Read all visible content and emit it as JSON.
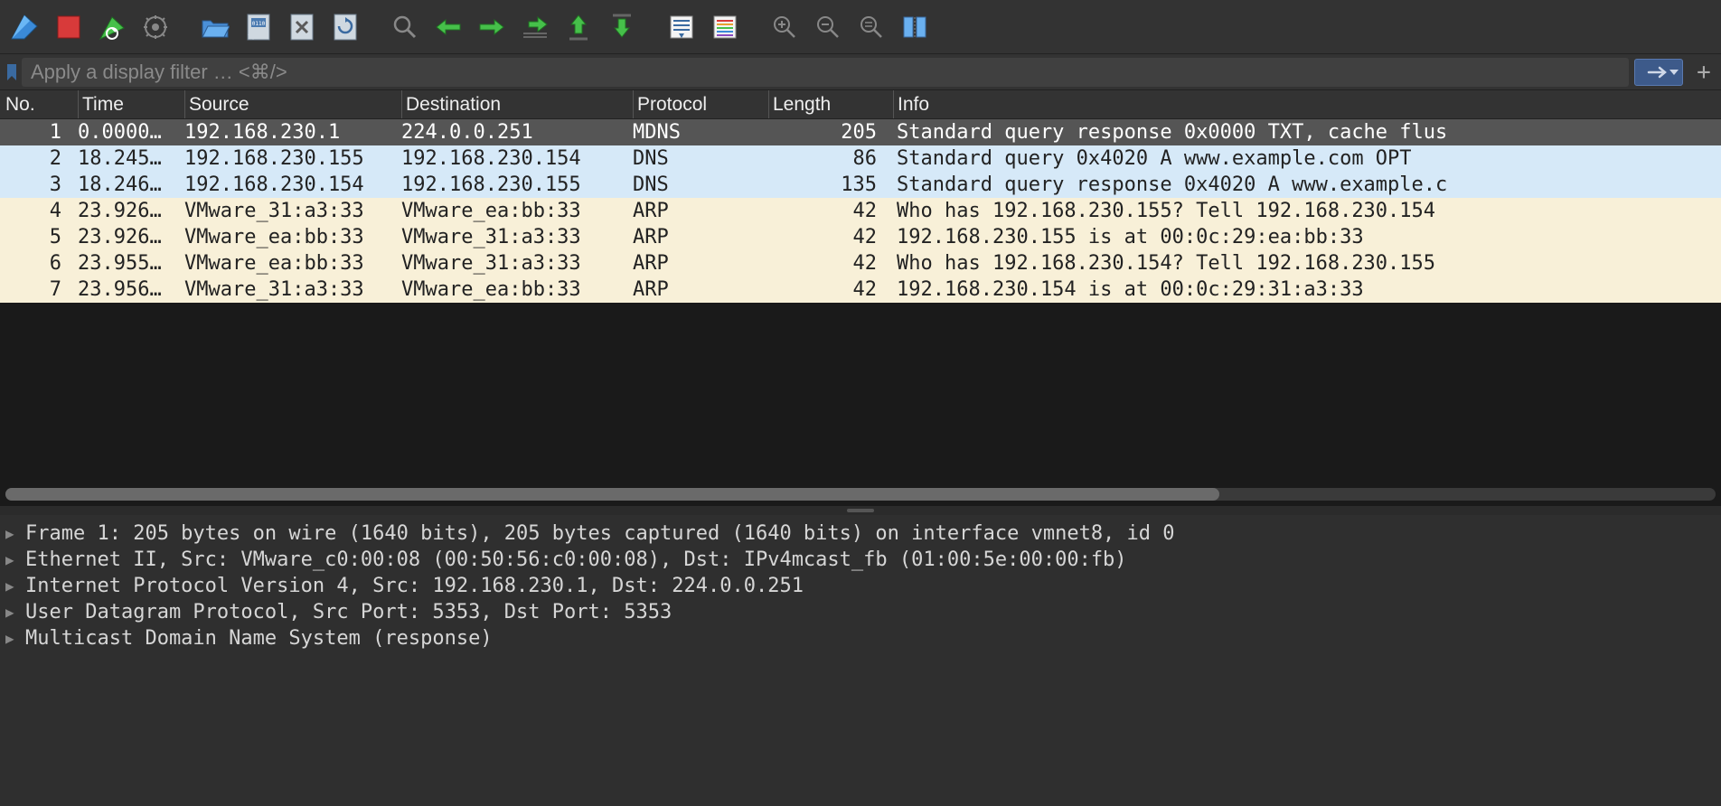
{
  "toolbar": {
    "icons": [
      "fin-icon",
      "stop-icon",
      "restart-icon",
      "options-icon",
      "open-folder-icon",
      "save-icon",
      "close-file-icon",
      "reload-icon",
      "find-icon",
      "prev-icon",
      "next-icon",
      "jump-icon",
      "first-icon",
      "last-icon",
      "autoscroll-icon",
      "colorize-icon",
      "zoom-in-icon",
      "zoom-out-icon",
      "zoom-reset-icon",
      "resize-cols-icon"
    ]
  },
  "filter": {
    "placeholder": "Apply a display filter … <⌘/>",
    "go_label": "→",
    "plus_label": "+"
  },
  "columns": {
    "no": "No.",
    "time": "Time",
    "source": "Source",
    "destination": "Destination",
    "protocol": "Protocol",
    "length": "Length",
    "info": "Info"
  },
  "packets": [
    {
      "no": "1",
      "time": "0.0000…",
      "src": "192.168.230.1",
      "dst": "224.0.0.251",
      "proto": "MDNS",
      "len": "205",
      "info": "Standard query response 0x0000 TXT, cache flus",
      "class": "selected"
    },
    {
      "no": "2",
      "time": "18.245…",
      "src": "192.168.230.155",
      "dst": "192.168.230.154",
      "proto": "DNS",
      "len": "86",
      "info": "Standard query 0x4020 A www.example.com OPT",
      "class": "dns"
    },
    {
      "no": "3",
      "time": "18.246…",
      "src": "192.168.230.154",
      "dst": "192.168.230.155",
      "proto": "DNS",
      "len": "135",
      "info": "Standard query response 0x4020 A www.example.c",
      "class": "dns"
    },
    {
      "no": "4",
      "time": "23.926…",
      "src": "VMware_31:a3:33",
      "dst": "VMware_ea:bb:33",
      "proto": "ARP",
      "len": "42",
      "info": "Who has 192.168.230.155? Tell 192.168.230.154",
      "class": "arp"
    },
    {
      "no": "5",
      "time": "23.926…",
      "src": "VMware_ea:bb:33",
      "dst": "VMware_31:a3:33",
      "proto": "ARP",
      "len": "42",
      "info": "192.168.230.155 is at 00:0c:29:ea:bb:33",
      "class": "arp"
    },
    {
      "no": "6",
      "time": "23.955…",
      "src": "VMware_ea:bb:33",
      "dst": "VMware_31:a3:33",
      "proto": "ARP",
      "len": "42",
      "info": "Who has 192.168.230.154? Tell 192.168.230.155",
      "class": "arp"
    },
    {
      "no": "7",
      "time": "23.956…",
      "src": "VMware_31:a3:33",
      "dst": "VMware_ea:bb:33",
      "proto": "ARP",
      "len": "42",
      "info": "192.168.230.154 is at 00:0c:29:31:a3:33",
      "class": "arp"
    }
  ],
  "details": [
    "Frame 1: 205 bytes on wire (1640 bits), 205 bytes captured (1640 bits) on interface vmnet8, id 0",
    "Ethernet II, Src: VMware_c0:00:08 (00:50:56:c0:00:08), Dst: IPv4mcast_fb (01:00:5e:00:00:fb)",
    "Internet Protocol Version 4, Src: 192.168.230.1, Dst: 224.0.0.251",
    "User Datagram Protocol, Src Port: 5353, Dst Port: 5353",
    "Multicast Domain Name System (response)"
  ]
}
